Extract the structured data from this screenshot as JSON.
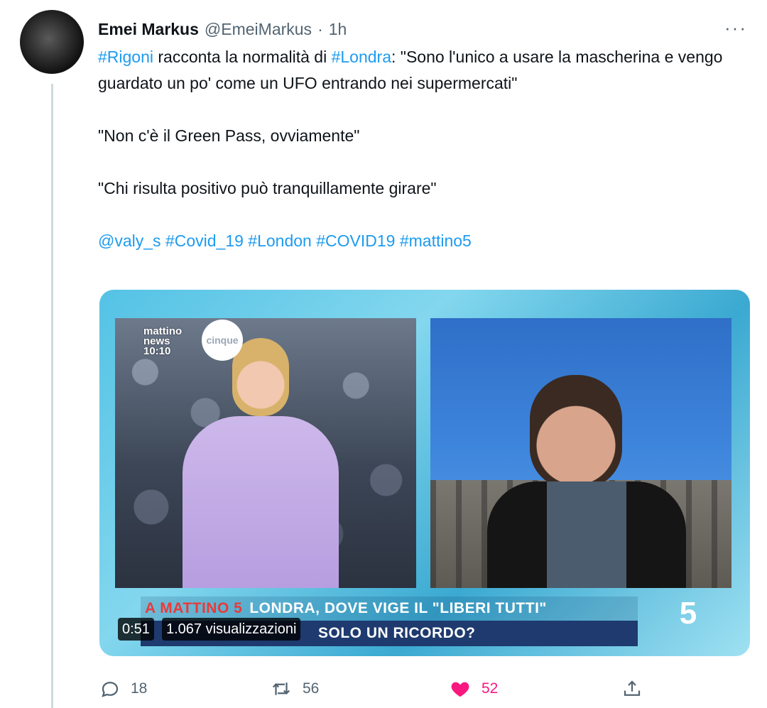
{
  "tweet": {
    "author_name": "Emei Markus",
    "author_handle": "@EmeiMarkus",
    "separator": "·",
    "time": "1h",
    "more": "···",
    "paragraph1": [
      {
        "text": "#Rigoni",
        "link": true
      },
      {
        "text": " racconta la normalità di ",
        "link": false
      },
      {
        "text": "#Londra",
        "link": true
      },
      {
        "text": ": \"Sono l'unico a usare la mascherina e vengo guardato un po' come un UFO entrando nei supermercati\"",
        "link": false
      }
    ],
    "paragraph2": "\"Non c'è il Green Pass, ovviamente\"",
    "paragraph3": "\"Chi risulta positivo può tranquillamente girare\"",
    "tags": [
      "@valy_s",
      "#Covid_19",
      "#London",
      "#COVID19",
      "#mattino5"
    ]
  },
  "video": {
    "news_logo_line1": "mattino",
    "news_logo_line2": "news",
    "news_logo_time": "10:10",
    "news_logo_badge": "cinque",
    "show_label": "A MATTINO 5",
    "headline_line1": "LONDRA, DOVE VIGE IL \"LIBERI TUTTI\"",
    "headline_line2": "SOLO UN RICORDO?",
    "channel_logo": "5",
    "duration": "0:51",
    "views": "1.067 visualizzazioni"
  },
  "actions": {
    "replies": "18",
    "retweets": "56",
    "likes": "52"
  },
  "colors": {
    "link": "#1d9bf0",
    "like": "#f91880",
    "muted": "#536471"
  }
}
